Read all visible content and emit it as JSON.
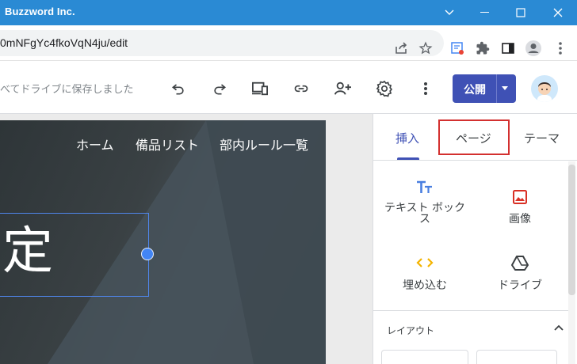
{
  "window": {
    "title": "Buzzword Inc."
  },
  "browser": {
    "url": "0mNFgYc4fkoVqN4ju/edit"
  },
  "toolbar": {
    "save_status": "べてドライブに保存しました",
    "publish_label": "公開"
  },
  "site": {
    "nav": [
      "ホーム",
      "備品リスト",
      "部内ルール一覧"
    ],
    "title_fragment": "定"
  },
  "panel": {
    "tabs": [
      "挿入",
      "ページ",
      "テーマ"
    ],
    "active_tab": "挿入",
    "highlighted_tab": "ページ",
    "insert_items": [
      {
        "label_line1": "テキスト ボック",
        "label_line2": "ス",
        "icon": "text-box-icon"
      },
      {
        "label_line1": "画像",
        "label_line2": "",
        "icon": "image-icon"
      },
      {
        "label_line1": "埋め込む",
        "label_line2": "",
        "icon": "embed-icon"
      },
      {
        "label_line1": "ドライブ",
        "label_line2": "",
        "icon": "drive-icon"
      }
    ],
    "section_label": "レイアウト"
  },
  "colors": {
    "titlebar": "#2a8ad4",
    "accent": "#3f51b5",
    "highlight_box": "#d3302f",
    "selection": "#4f86ec"
  }
}
